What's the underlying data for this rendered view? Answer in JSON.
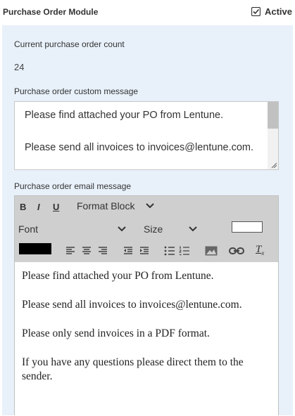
{
  "header": {
    "title": "Purchase Order Module",
    "active_label": "Active"
  },
  "count_section": {
    "label": "Current purchase order count",
    "value": "24"
  },
  "custom_message": {
    "label": "Purchase order custom message",
    "text": "Please find attached your PO from Lentune.\n\nPlease send all invoices to invoices@lentune.com."
  },
  "email_message": {
    "label": "Purchase order email message",
    "toolbar": {
      "bold": "B",
      "italic": "I",
      "underline": "U",
      "format_block": "Format Block",
      "font": "Font",
      "size": "Size",
      "clear_format": "T"
    },
    "paragraphs": [
      "Please find attached your PO from Lentune.",
      "Please send all invoices to invoices@lentune.com.",
      "Please only send invoices in a PDF format.",
      "If you have any questions please direct them to the sender."
    ]
  }
}
